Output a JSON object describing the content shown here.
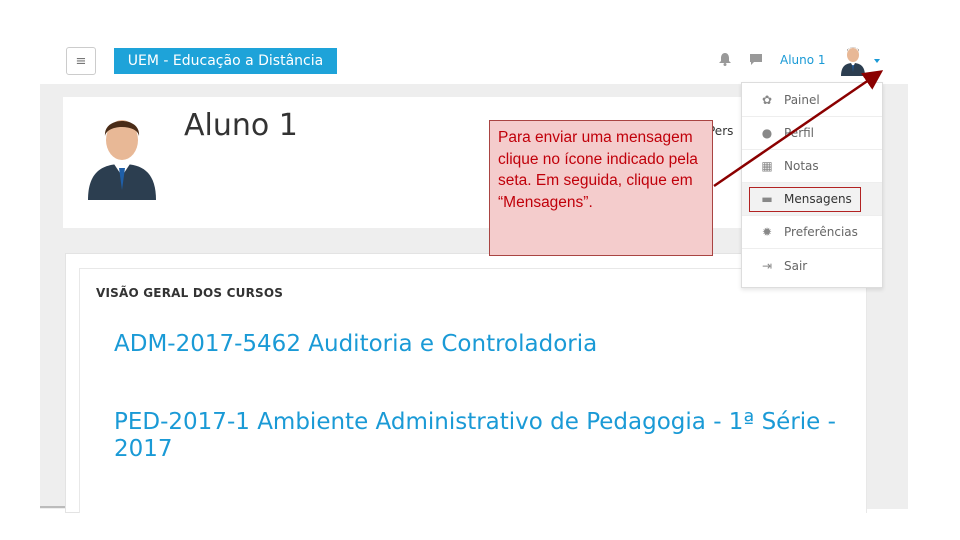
{
  "navbar": {
    "menu_icon": "≡",
    "brand": "UEM - Educação a Distância",
    "username": "Aluno 1",
    "icons": [
      "bell-icon",
      "chat-icon",
      "avatar",
      "caret-down-icon"
    ]
  },
  "profile": {
    "name": "Aluno 1",
    "customize_button": "Pers"
  },
  "courses": {
    "heading": "VISÃO GERAL DOS CURSOS",
    "items": [
      {
        "title": "ADM-2017-5462 Auditoria e Controladoria"
      },
      {
        "title": "PED-2017-1 Ambiente Administrativo de Pedagogia - 1ª Série - 2017"
      }
    ]
  },
  "user_menu": {
    "items": [
      {
        "label": "Painel",
        "icon": "dashboard-icon"
      },
      {
        "label": "Perfil",
        "icon": "user-icon"
      },
      {
        "label": "Notas",
        "icon": "grades-icon"
      },
      {
        "label": "Mensagens",
        "icon": "message-icon"
      },
      {
        "label": "Preferências",
        "icon": "gear-icon"
      },
      {
        "label": "Sair",
        "icon": "logout-icon"
      }
    ],
    "highlighted": "Mensagens"
  },
  "annotation": {
    "text": "Para enviar uma mensagem clique no ícone indicado pela seta. Em seguida, clique em “Mensagens”.",
    "arrow_color": "#8b0000"
  },
  "colors": {
    "brand": "#1ea3d9",
    "link": "#1a9ad6",
    "callout_bg": "#f4cccc",
    "callout_text": "#c0000a"
  }
}
